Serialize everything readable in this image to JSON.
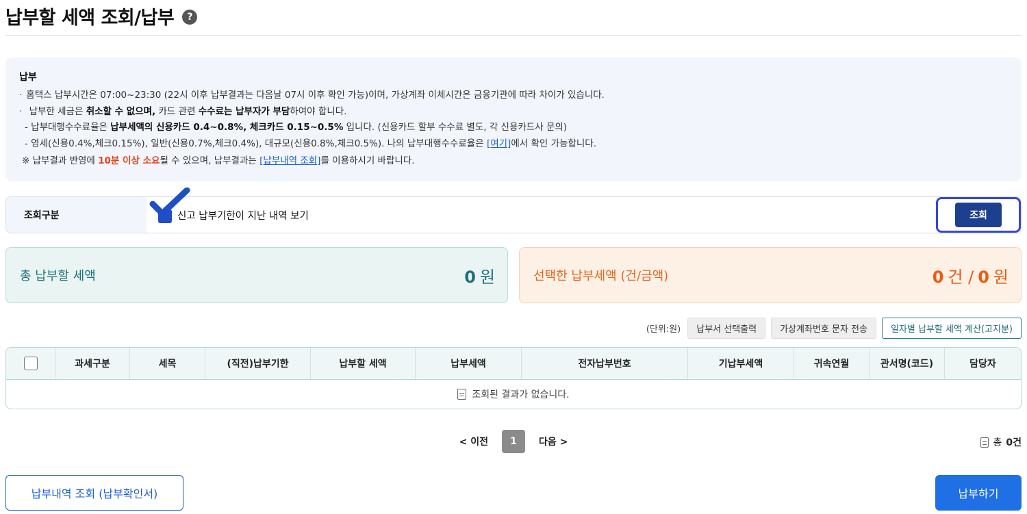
{
  "page": {
    "title": "납부할 세액 조회/납부",
    "help_icon_glyph": "?"
  },
  "notice": {
    "title": "납부",
    "line1": "홈택스 납부시간은 07:00~23:30 (22시 이후 납부결과는 다음날 07시 이후 확인 가능)이며, 가상계좌 이체시간은 금융기관에 따라 차이가 있습니다.",
    "line2": {
      "p1": "납부한 세금은 ",
      "b1": "취소할 수 없으며,",
      "p2": " 카드 관련 ",
      "b2": "수수료는 납부자가 부담",
      "p3": "하여야 합니다."
    },
    "line3": {
      "p1": "- 납부대행수수료율은 ",
      "b1": "납부세액의 신용카드 0.4~0.8%, 체크카드 0.15~0.5%",
      "p2": " 입니다. (신용카드 할부 수수료 별도, 각 신용카드사 문의)"
    },
    "line4": {
      "p1": "- 영세(신용0.4%,체크0.15%), 일반(신용0.7%,체크0.4%), 대규모(신용0.8%,체크0.5%). 나의 납부대행수수료율은 ",
      "link": "[여기]",
      "p2": "에서 확인 가능합니다."
    },
    "line5": {
      "p1": "※ 납부결과 반영에 ",
      "red": "10분 이상 소요",
      "p2": "될 수 있으며, 납부결과는 ",
      "link": "[납부내역 조회]",
      "p3": "를 이용하시기 바랍니다."
    }
  },
  "search": {
    "label": "조회구분",
    "checkbox_label": "신고 납부기한이 지난 내역 보기",
    "checkbox_checked": true,
    "button": "조회"
  },
  "summary": {
    "total_label": "총 납부할 세액",
    "total_amount": "0",
    "total_unit": "원",
    "selected_label": "선택한 납부세액 (건/금액)",
    "selected_count": "0",
    "selected_count_unit": "건 /",
    "selected_amount": "0",
    "selected_amount_unit": "원"
  },
  "toolbar": {
    "unit_note": "(단위:원)",
    "print_button": "납부서 선택출력",
    "sms_button": "가상계좌번호 문자 전송",
    "calc_button": "일자별 납부할 세액 계산(고지분)"
  },
  "table": {
    "columns": [
      "과세구분",
      "세목",
      "(직전)납부기한",
      "납부할 세액",
      "납부세액",
      "전자납부번호",
      "기납부세액",
      "귀속연월",
      "관서명(코드)",
      "담당자"
    ],
    "empty_message": "조회된 결과가 없습니다."
  },
  "pagination": {
    "prev": "< 이전",
    "current": "1",
    "next": "다음 >",
    "total_prefix": "총",
    "total_count": "0건"
  },
  "actions": {
    "history_button": "납부내역 조회 (납부확인서)",
    "pay_button": "납부하기"
  },
  "colors": {
    "primary_blue": "#1f6fe5",
    "navy_button": "#1d3f8f",
    "teal": "#1f6f7c",
    "orange": "#ec5b13",
    "highlight_outline": "#3545e0"
  }
}
